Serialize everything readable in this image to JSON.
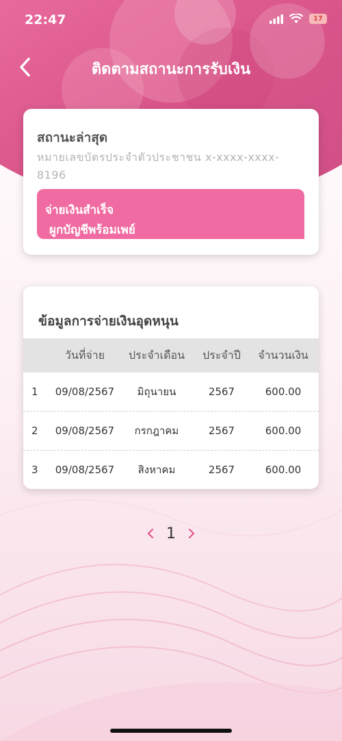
{
  "status_bar": {
    "time": "22:47",
    "battery": "17"
  },
  "header": {
    "title": "ติดตามสถานะการรับเงิน"
  },
  "status_card": {
    "heading": "สถานะล่าสุด",
    "id_line": "หมายเลขบัตรประจำตัวประชาชน x-xxxx-xxxx-8196",
    "status_line1": "จ่ายเงินสำเร็จ",
    "status_line2": "ผูกบัญชีพร้อมเพย์"
  },
  "payment_card": {
    "title": "ข้อมูลการจ่ายเงินอุดหนุน",
    "columns": {
      "date": "วันที่จ่าย",
      "month": "ประจำเดือน",
      "year": "ประจำปี",
      "amount": "จำนวนเงิน"
    },
    "rows": [
      {
        "no": "1",
        "date": "09/08/2567",
        "month": "มิถุนายน",
        "year": "2567",
        "amount": "600.00"
      },
      {
        "no": "2",
        "date": "09/08/2567",
        "month": "กรกฎาคม",
        "year": "2567",
        "amount": "600.00"
      },
      {
        "no": "3",
        "date": "09/08/2567",
        "month": "สิงหาคม",
        "year": "2567",
        "amount": "600.00"
      }
    ]
  },
  "pagination": {
    "current_page": "1"
  },
  "colors": {
    "accent": "#e0588f",
    "pill": "#f06ba1",
    "header": "#d95a8a"
  }
}
